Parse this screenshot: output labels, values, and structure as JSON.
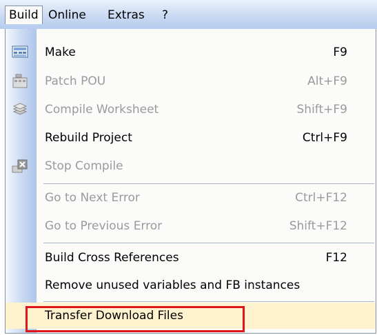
{
  "menubar": {
    "items": [
      {
        "label": "Build"
      },
      {
        "label": "Online"
      },
      {
        "label": "Extras"
      },
      {
        "label": "?"
      }
    ]
  },
  "menu": {
    "items": [
      {
        "label": "Make",
        "shortcut": "F9",
        "enabled": true,
        "icon": "make-icon"
      },
      {
        "label": "Patch POU",
        "shortcut": "Alt+F9",
        "enabled": false,
        "icon": "patch-pou-icon"
      },
      {
        "label": "Compile Worksheet",
        "shortcut": "Shift+F9",
        "enabled": false,
        "icon": "compile-worksheet-icon"
      },
      {
        "label": "Rebuild Project",
        "shortcut": "Ctrl+F9",
        "enabled": true
      },
      {
        "label": "Stop Compile",
        "shortcut": "",
        "enabled": false,
        "icon": "stop-compile-icon"
      },
      {
        "label": "Go to Next Error",
        "shortcut": "Ctrl+F12",
        "enabled": false
      },
      {
        "label": "Go to Previous Error",
        "shortcut": "Shift+F12",
        "enabled": false
      },
      {
        "label": "Build Cross References",
        "shortcut": "F12",
        "enabled": true
      },
      {
        "label": "Remove unused variables and FB instances",
        "shortcut": "",
        "enabled": true
      },
      {
        "label": "Transfer Download Files",
        "shortcut": "",
        "enabled": true,
        "highlighted": true
      }
    ]
  },
  "colors": {
    "highlight_box": "#e0141b",
    "menubar": "#c7d8f2"
  }
}
